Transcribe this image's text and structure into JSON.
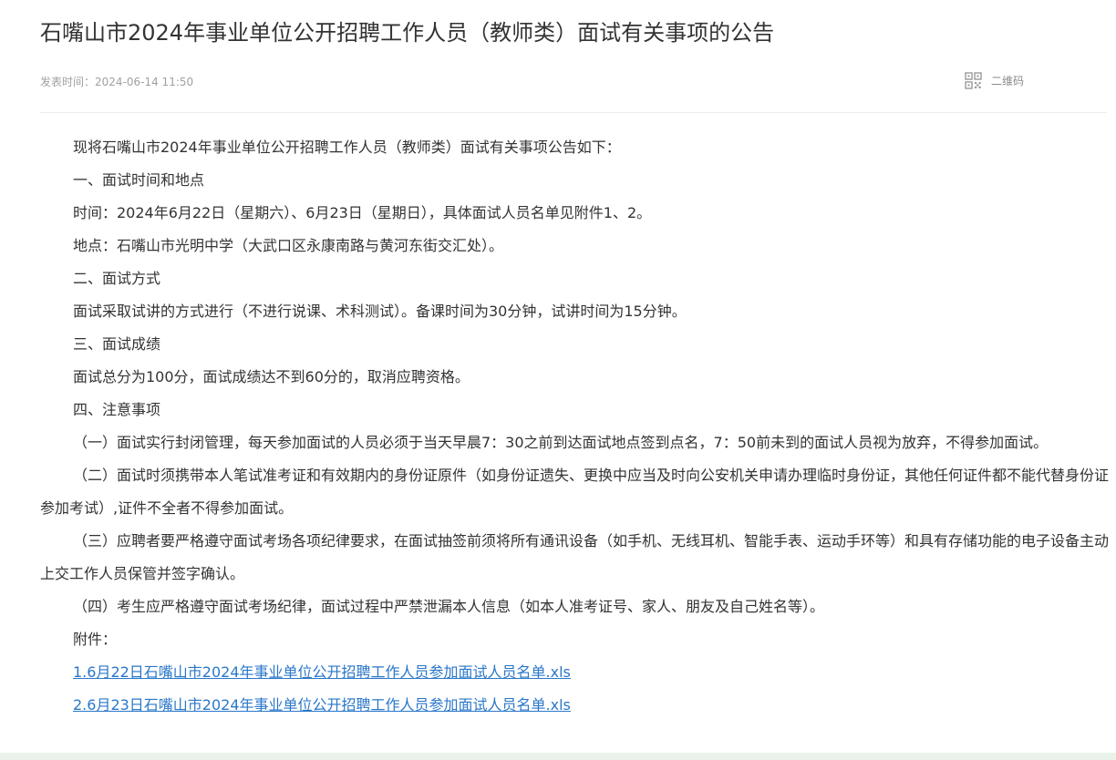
{
  "article": {
    "title": "石嘴山市2024年事业单位公开招聘工作人员（教师类）面试有关事项的公告",
    "publish_label": "发表时间：2024-06-14 11:50",
    "qr_label": "二维码"
  },
  "content": {
    "p1": "现将石嘴山市2024年事业单位公开招聘工作人员（教师类）面试有关事项公告如下：",
    "h1": "一、面试时间和地点",
    "time": "时间：2024年6月22日（星期六）、6月23日（星期日），具体面试人员名单见附件1、2。",
    "place": "地点：石嘴山市光明中学（大武口区永康南路与黄河东街交汇处）。",
    "h2": "二、面试方式",
    "method": "面试采取试讲的方式进行（不进行说课、术科测试）。备课时间为30分钟，试讲时间为15分钟。",
    "h3": "三、面试成绩",
    "score": "面试总分为100分，面试成绩达不到60分的，取消应聘资格。",
    "h4": "四、注意事项",
    "n1": "（一）面试实行封闭管理，每天参加面试的人员必须于当天早晨7：30之前到达面试地点签到点名，7：50前未到的面试人员视为放弃，不得参加面试。",
    "n2": "（二）面试时须携带本人笔试准考证和有效期内的身份证原件（如身份证遗失、更换中应当及时向公安机关申请办理临时身份证，其他任何证件都不能代替身份证参加考试）,证件不全者不得参加面试。",
    "n3": "（三）应聘者要严格遵守面试考场各项纪律要求，在面试抽签前须将所有通讯设备（如手机、无线耳机、智能手表、运动手环等）和具有存储功能的电子设备主动上交工作人员保管并签字确认。",
    "n4": "（四）考生应严格遵守面试考场纪律，面试过程中严禁泄漏本人信息（如本人准考证号、家人、朋友及自己姓名等）。",
    "attachments_label": "附件：",
    "attachment1": "1.6月22日石嘴山市2024年事业单位公开招聘工作人员参加面试人员名单.xls",
    "attachment2": "2.6月23日石嘴山市2024年事业单位公开招聘工作人员参加面试人员名单.xls"
  },
  "colors": {
    "text": "#333333",
    "meta": "#a0a0a0",
    "link": "#2a77c9"
  }
}
